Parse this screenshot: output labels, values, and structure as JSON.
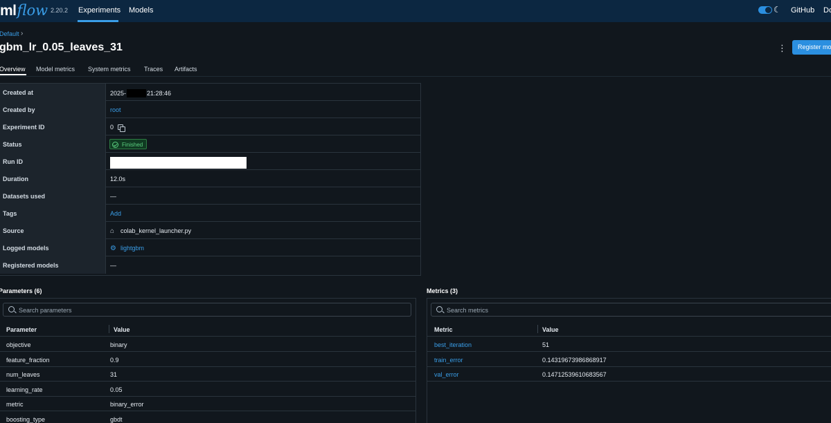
{
  "nav": {
    "logo_ml": "ml",
    "logo_flow": "flow",
    "version": "2.20.2",
    "experiments": "Experiments",
    "models": "Models",
    "moon": "☾",
    "github": "GitHub",
    "docs": "Do"
  },
  "header": {
    "breadcrumb": "Default",
    "breadcrumb_sep": "›",
    "title": "gbm_lr_0.05_leaves_31",
    "kebab": "⋮",
    "register_button": "Register mo"
  },
  "tabs": [
    "Overview",
    "Model metrics",
    "System metrics",
    "Traces",
    "Artifacts"
  ],
  "details": {
    "created_at": {
      "label": "Created at",
      "value_prefix": "2025-",
      "value_suffix": "21:28:46"
    },
    "created_by": {
      "label": "Created by",
      "value": "root"
    },
    "experiment_id": {
      "label": "Experiment ID",
      "value": "0"
    },
    "status": {
      "label": "Status",
      "value": "Finished"
    },
    "run_id": {
      "label": "Run ID"
    },
    "duration": {
      "label": "Duration",
      "value": "12.0s"
    },
    "datasets_used": {
      "label": "Datasets used",
      "value": "—"
    },
    "tags": {
      "label": "Tags",
      "value": "Add"
    },
    "source": {
      "label": "Source",
      "value": "colab_kernel_launcher.py"
    },
    "logged_models": {
      "label": "Logged models",
      "value": "lightgbm"
    },
    "registered_models": {
      "label": "Registered models",
      "value": "—"
    }
  },
  "parameters": {
    "title": "Parameters (6)",
    "search_placeholder": "Search parameters",
    "col_param": "Parameter",
    "col_value": "Value",
    "rows": [
      {
        "name": "objective",
        "value": "binary"
      },
      {
        "name": "feature_fraction",
        "value": "0.9"
      },
      {
        "name": "num_leaves",
        "value": "31"
      },
      {
        "name": "learning_rate",
        "value": "0.05"
      },
      {
        "name": "metric",
        "value": "binary_error"
      },
      {
        "name": "boosting_type",
        "value": "gbdt"
      }
    ]
  },
  "metrics": {
    "title": "Metrics (3)",
    "search_placeholder": "Search metrics",
    "col_metric": "Metric",
    "col_value": "Value",
    "rows": [
      {
        "name": "best_iteration",
        "value": "51"
      },
      {
        "name": "train_error",
        "value": "0.14319673986868917"
      },
      {
        "name": "val_error",
        "value": "0.14712539610683567"
      }
    ]
  },
  "colors": {
    "nav_bg": "#0c2741",
    "page_bg": "#11171d",
    "accent": "#3a9ee8",
    "success": "#5ccf80"
  }
}
